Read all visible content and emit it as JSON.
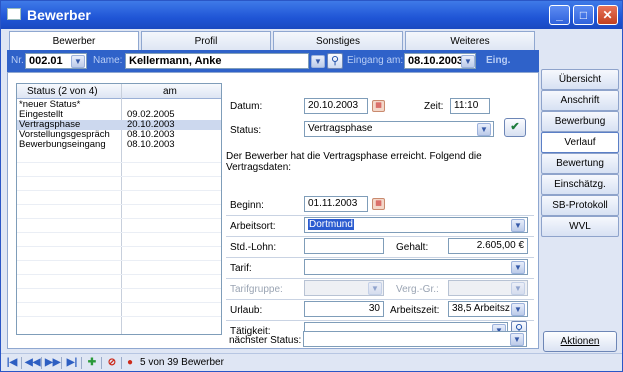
{
  "window": {
    "title": "Bewerber"
  },
  "tabs": [
    "Bewerber",
    "Profil",
    "Sonstiges",
    "Weiteres"
  ],
  "header": {
    "nr_label": "Nr.",
    "nr_value": "002.01",
    "name_label": "Name:",
    "name_value": "Kellermann, Anke",
    "eingang_label": "Eingang am:",
    "eingang_value": "08.10.2003",
    "eing_link": "Eing."
  },
  "status_table": {
    "col_status": "Status (2 von 4)",
    "col_am": "am",
    "rows": [
      {
        "status": "*neuer Status*",
        "am": ""
      },
      {
        "status": "Eingestellt",
        "am": "09.02.2005"
      },
      {
        "status": "Vertragsphase",
        "am": "20.10.2003"
      },
      {
        "status": "Vorstellungsgespräch",
        "am": "08.10.2003"
      },
      {
        "status": "Bewerbungseingang",
        "am": "08.10.2003"
      }
    ],
    "selected_index": 2
  },
  "form": {
    "datum_label": "Datum:",
    "datum_value": "20.10.2003",
    "zeit_label": "Zeit:",
    "zeit_value": "11:10",
    "status_label": "Status:",
    "status_value": "Vertragsphase",
    "description": "Der Bewerber hat die Vertragsphase erreicht. Folgend die Vertragsdaten:",
    "beginn_label": "Beginn:",
    "beginn_value": "01.11.2003",
    "arbeitsort_label": "Arbeitsort:",
    "arbeitsort_value": "Dortmund",
    "stdlohn_label": "Std.-Lohn:",
    "stdlohn_value": "",
    "gehalt_label": "Gehalt:",
    "gehalt_value": "2.605,00 €",
    "tarif_label": "Tarif:",
    "tarif_value": "",
    "tarifgruppe_label": "Tarifgruppe:",
    "tarifgruppe_value": "",
    "verggr_label": "Verg.-Gr.:",
    "verggr_value": "",
    "urlaub_label": "Urlaub:",
    "urlaub_value": "30",
    "arbeitszeit_label": "Arbeitszeit:",
    "arbeitszeit_value": "38,5 Arbeitsz",
    "taetigkeit_label": "Tätigkeit:",
    "taetigkeit_value": "",
    "naechster_label": "nächster Status:",
    "naechster_value": ""
  },
  "right_nav": {
    "items": [
      "Übersicht",
      "Anschrift",
      "Bewerbung",
      "Verlauf",
      "Bewertung",
      "Einschätzg.",
      "SB-Protokoll",
      "WVL"
    ],
    "active_index": 3,
    "aktionen": "Aktionen"
  },
  "statusbar": {
    "record_count": "5 von 39 Bewerber"
  },
  "colors": {
    "title_blue": "#1f55d6",
    "strip_blue": "#2f62c9",
    "selected_row": "#ccd8ee"
  }
}
